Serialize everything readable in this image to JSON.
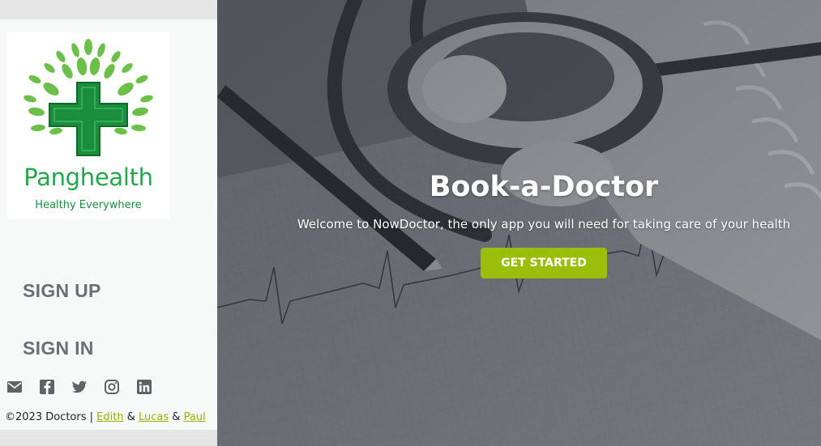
{
  "brand": {
    "name": "Panghealth",
    "tagline": "Healthy Everywhere",
    "colors": {
      "leaf": "#6cc04a",
      "cross": "#1a8e3c",
      "text": "#21a84a"
    }
  },
  "sidebar": {
    "nav": [
      {
        "label": "SIGN UP"
      },
      {
        "label": "SIGN IN"
      }
    ],
    "socials": [
      "mail-icon",
      "facebook-icon",
      "twitter-icon",
      "instagram-icon",
      "linkedin-icon"
    ],
    "footer": {
      "prefix": "©2023 Doctors |",
      "authors": [
        "Edith",
        "Lucas",
        "Paul"
      ],
      "separator": "&"
    }
  },
  "hero": {
    "title": "Book-a-Doctor",
    "subtitle": "Welcome to NowDoctor, the only app you will need for taking care of your health",
    "cta_label": "GET STARTED",
    "colors": {
      "cta": "#9bbe0b",
      "overlay": "#3c4048"
    }
  }
}
